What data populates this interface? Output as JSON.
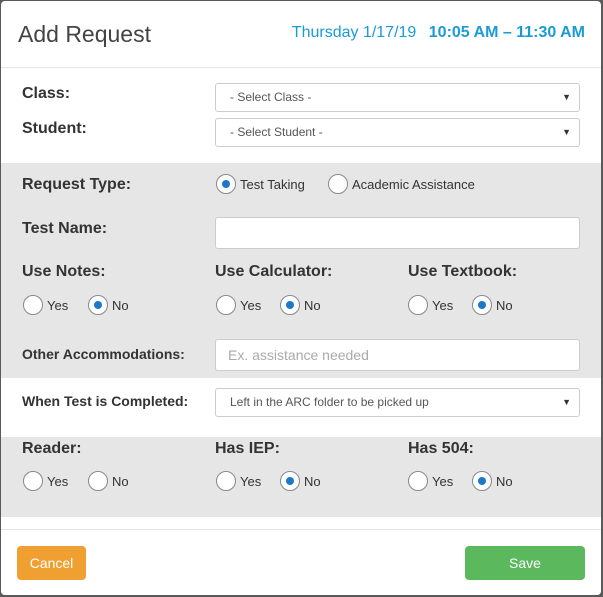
{
  "modal": {
    "title": "Add Request",
    "day_date": "Thursday 1/17/19",
    "time_range": "10:05 AM – 11:30 AM"
  },
  "class": {
    "label": "Class:",
    "selected": "- Select Class -"
  },
  "student": {
    "label": "Student:",
    "selected": "- Select Student -"
  },
  "request_type": {
    "label": "Request Type:",
    "options": [
      {
        "label": "Test Taking",
        "selected": true
      },
      {
        "label": "Academic Assistance",
        "selected": false
      }
    ]
  },
  "test_name": {
    "label": "Test Name:",
    "value": ""
  },
  "yes_no_options": [
    "Yes",
    "No"
  ],
  "use_notes": {
    "label": "Use Notes:",
    "selected": "No"
  },
  "use_calculator": {
    "label": "Use Calculator:",
    "selected": "No"
  },
  "use_textbook": {
    "label": "Use Textbook:",
    "selected": "No"
  },
  "other_accommodations": {
    "label": "Other Accommodations:",
    "placeholder": "Ex. assistance needed"
  },
  "when_completed": {
    "label": "When Test is Completed:",
    "selected": "Left in the ARC folder to be picked up"
  },
  "reader": {
    "label": "Reader:",
    "selected": "none"
  },
  "has_iep": {
    "label": "Has IEP:",
    "selected": "No"
  },
  "has_504": {
    "label": "Has 504:",
    "selected": "No"
  },
  "footer": {
    "cancel_label": "Cancel",
    "save_label": "Save"
  }
}
